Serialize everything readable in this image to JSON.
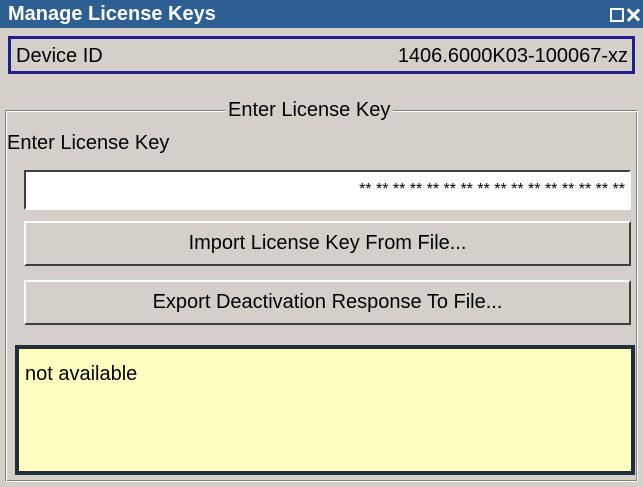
{
  "window": {
    "title": "Manage License Keys"
  },
  "device": {
    "label": "Device ID",
    "value": "1406.6000K03-100067-xz"
  },
  "license_group": {
    "title": "Enter License Key",
    "field_label": "Enter License Key",
    "key_value": "** ** ** ** ** ** ** ** ** ** ** ** ** ** ** **",
    "import_button": "Import License Key From File...",
    "export_button": "Export Deactivation Response To File..."
  },
  "status": {
    "text": "not available"
  },
  "colors": {
    "titlebar": "#2e5f93",
    "panel": "#d4d0c8",
    "status_background": "#ffffc0",
    "focus_border": "#1e1e8c"
  }
}
